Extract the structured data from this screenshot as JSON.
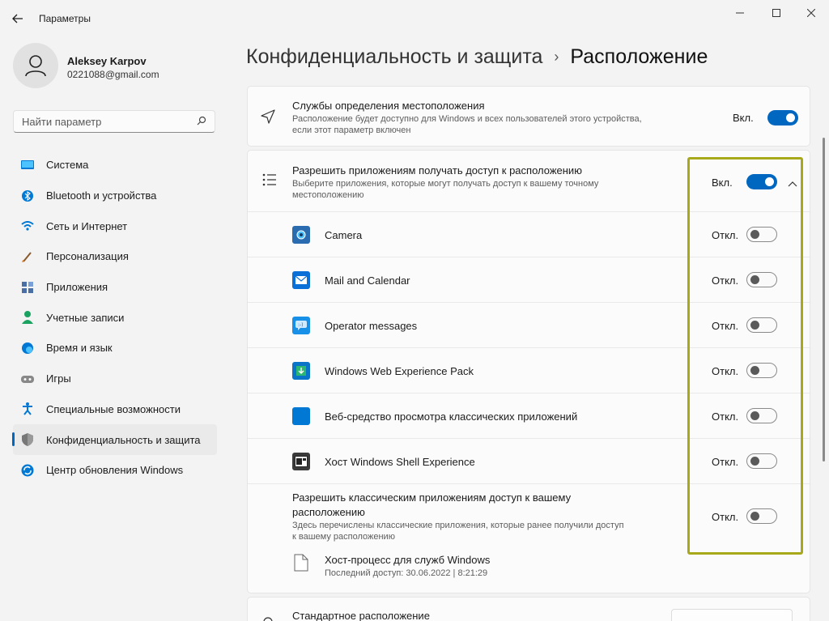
{
  "window": {
    "title": "Параметры",
    "back_icon": "arrow-left-icon",
    "minimize": "—",
    "maximize": "☐",
    "close": "✕"
  },
  "profile": {
    "name": "Aleksey Karpov",
    "email": "0221088@gmail.com"
  },
  "search": {
    "placeholder": "Найти параметр",
    "icon": "⌕"
  },
  "sidebar": {
    "items": [
      {
        "label": "Система",
        "icon": "system-icon",
        "color": "#0078d4"
      },
      {
        "label": "Bluetooth и устройства",
        "icon": "bluetooth-icon",
        "color": "#0078d4"
      },
      {
        "label": "Сеть и Интернет",
        "icon": "wifi-icon",
        "color": "#0078d4"
      },
      {
        "label": "Персонализация",
        "icon": "brush-icon",
        "color": "#e67e22"
      },
      {
        "label": "Приложения",
        "icon": "apps-icon",
        "color": "#4a6fa5"
      },
      {
        "label": "Учетные записи",
        "icon": "account-icon",
        "color": "#1aa260"
      },
      {
        "label": "Время и язык",
        "icon": "globe-icon",
        "color": "#0078d4"
      },
      {
        "label": "Игры",
        "icon": "gamepad-icon",
        "color": "#666666"
      },
      {
        "label": "Специальные возможности",
        "icon": "accessibility-icon",
        "color": "#0078d4"
      },
      {
        "label": "Конфиденциальность и защита",
        "icon": "shield-icon",
        "color": "#666666",
        "active": true
      },
      {
        "label": "Центр обновления Windows",
        "icon": "update-icon",
        "color": "#0078d4"
      }
    ]
  },
  "breadcrumb": {
    "parent": "Конфиденциальность и защита",
    "separator": "›",
    "current": "Расположение"
  },
  "location_services": {
    "title": "Службы определения местоположения",
    "desc_line1": "Расположение будет доступно для Windows и всех пользователей этого устройства,",
    "desc_line2": "если этот параметр включен",
    "state": "Вкл."
  },
  "app_access": {
    "title": "Разрешить приложениям получать доступ к расположению",
    "desc_line1": "Выберите приложения, которые могут получать доступ к вашему точному",
    "desc_line2": "местоположению",
    "state": "Вкл.",
    "chevron": "⌃"
  },
  "apps": [
    {
      "name": "Camera",
      "state": "Откл.",
      "icon": "camera-icon",
      "color": "#2b6cb0"
    },
    {
      "name": "Mail and Calendar",
      "state": "Откл.",
      "icon": "mail-icon",
      "color": "#0a6fd6"
    },
    {
      "name": "Operator messages",
      "state": "Откл.",
      "icon": "message-icon",
      "color": "#1890e8"
    },
    {
      "name": "Windows Web Experience Pack",
      "state": "Откл.",
      "icon": "web-pack-icon",
      "color": "#0a74c9"
    },
    {
      "name": "Веб-средство просмотра классических приложений",
      "state": "Откл.",
      "icon": "blue-square-icon",
      "color": "#0078d4"
    },
    {
      "name": "Хост Windows Shell Experience",
      "state": "Откл.",
      "icon": "shell-icon",
      "color": "#3a3a3a"
    }
  ],
  "classic_apps": {
    "title_line1": "Разрешить классическим приложениям доступ к вашему",
    "title_line2": "расположению",
    "desc_line1": "Здесь перечислены классические приложения, которые ранее получили доступ",
    "desc_line2": "к вашему расположению",
    "state": "Откл.",
    "host_title": "Хост-процесс для служб Windows",
    "host_sub": "Последний доступ: 30.06.2022  |  8:21:29"
  },
  "default_location": {
    "title": "Стандартное расположение"
  }
}
